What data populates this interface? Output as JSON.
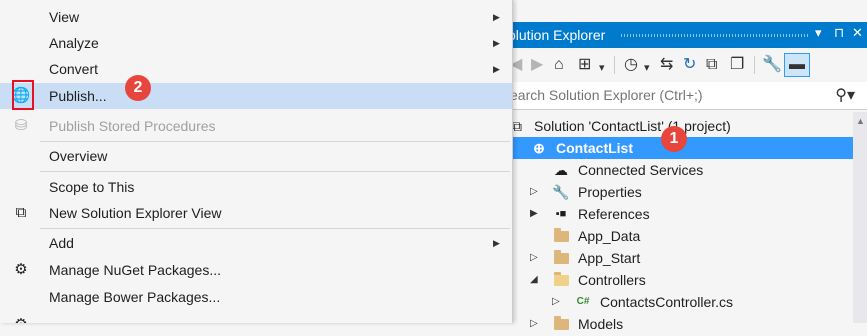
{
  "menu": {
    "items": [
      {
        "label": "View",
        "icon": "",
        "submenu": true
      },
      {
        "label": "Analyze",
        "icon": "",
        "submenu": true
      },
      {
        "label": "Convert",
        "icon": "",
        "submenu": true
      },
      {
        "label": "Publish...",
        "icon": "globe-publish-icon",
        "highlighted": true
      },
      {
        "label": "Publish Stored Procedures",
        "icon": "database-icon",
        "disabled": true
      },
      {
        "label": "Overview",
        "icon": ""
      },
      {
        "label": "Scope to This",
        "icon": ""
      },
      {
        "label": "New Solution Explorer View",
        "icon": "new-window-icon"
      },
      {
        "label": "Add",
        "icon": "",
        "submenu": true
      },
      {
        "label": "Manage NuGet Packages...",
        "icon": "nuget-icon"
      },
      {
        "label": "Manage Bower Packages...",
        "icon": ""
      }
    ]
  },
  "callouts": {
    "publish": "2",
    "project": "1",
    "color": "#e8453c"
  },
  "solution_explorer": {
    "title": "olution Explorer",
    "title_buttons": {
      "dropdown": "▾",
      "pin": "⊓",
      "close": "✕"
    },
    "search_placeholder": "earch Solution Explorer (Ctrl+;)",
    "accent_color": "#007acc",
    "tree": [
      {
        "label": "Solution 'ContactList' (1 project)",
        "icon": "solution-icon"
      },
      {
        "label": "ContactList",
        "icon": "web-project-icon",
        "selected": true
      },
      {
        "label": "Connected Services",
        "icon": "connected-services-icon"
      },
      {
        "label": "Properties",
        "icon": "wrench-icon"
      },
      {
        "label": "References",
        "icon": "references-icon"
      },
      {
        "label": "App_Data",
        "icon": "folder-icon"
      },
      {
        "label": "App_Start",
        "icon": "folder-icon"
      },
      {
        "label": "Controllers",
        "icon": "folder-open-icon"
      },
      {
        "label": "ContactsController.cs",
        "icon": "csharp-file-icon"
      },
      {
        "label": "Models",
        "icon": "folder-icon"
      }
    ]
  }
}
